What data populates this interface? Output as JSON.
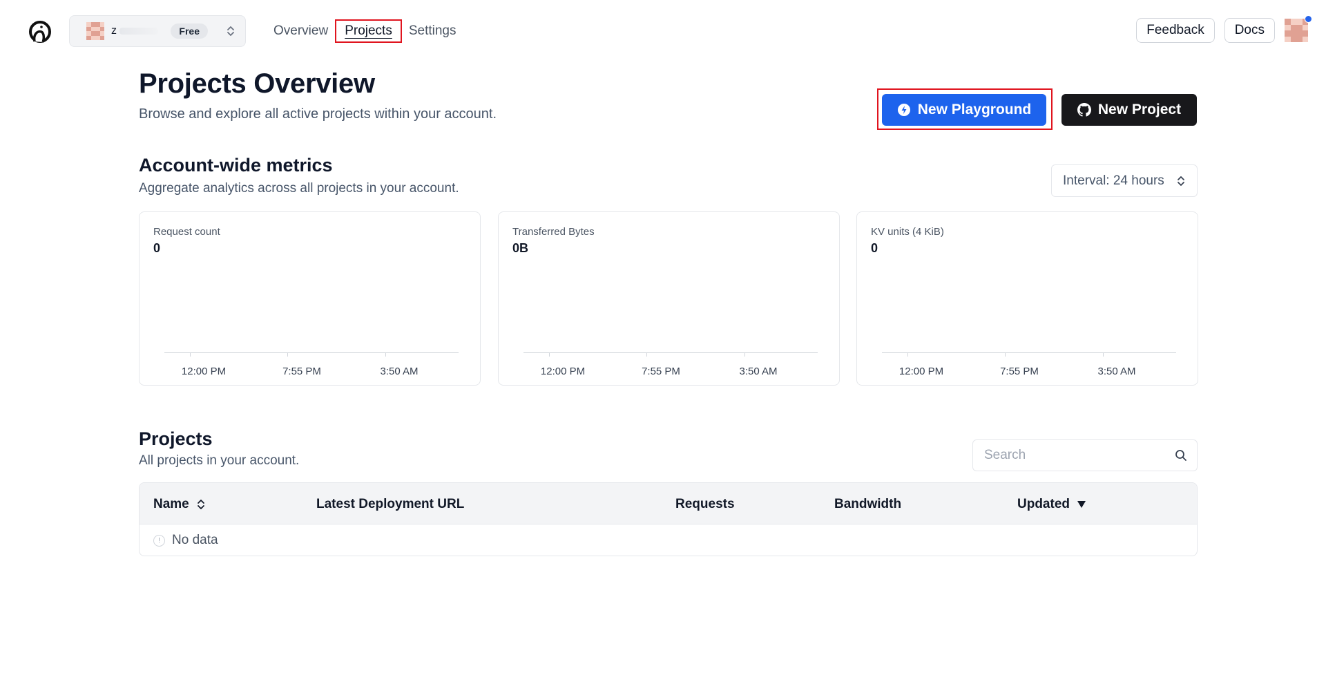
{
  "nav": {
    "org_name": "z",
    "plan": "Free",
    "tabs": [
      {
        "label": "Overview"
      },
      {
        "label": "Projects"
      },
      {
        "label": "Settings"
      }
    ],
    "feedback_label": "Feedback",
    "docs_label": "Docs"
  },
  "header": {
    "title": "Projects Overview",
    "subtitle": "Browse and explore all active projects within your account.",
    "new_playground_label": "New Playground",
    "new_project_label": "New Project"
  },
  "metrics": {
    "title": "Account-wide metrics",
    "subtitle": "Aggregate analytics across all projects in your account.",
    "interval_label": "Interval: 24 hours",
    "cards": [
      {
        "label": "Request count",
        "value": "0",
        "ticks": [
          "12:00 PM",
          "7:55 PM",
          "3:50 AM"
        ]
      },
      {
        "label": "Transferred Bytes",
        "value": "0B",
        "ticks": [
          "12:00 PM",
          "7:55 PM",
          "3:50 AM"
        ]
      },
      {
        "label": "KV units (4 KiB)",
        "value": "0",
        "ticks": [
          "12:00 PM",
          "7:55 PM",
          "3:50 AM"
        ]
      }
    ]
  },
  "projects": {
    "title": "Projects",
    "subtitle": "All projects in your account.",
    "search_placeholder": "Search",
    "columns": [
      "Name",
      "Latest Deployment URL",
      "Requests",
      "Bandwidth",
      "Updated"
    ],
    "empty_text": "No data"
  },
  "colors": {
    "primary": "#1d63ed",
    "dark_button": "#18181b",
    "highlight": "#e0141e",
    "notification": "#2563eb"
  }
}
